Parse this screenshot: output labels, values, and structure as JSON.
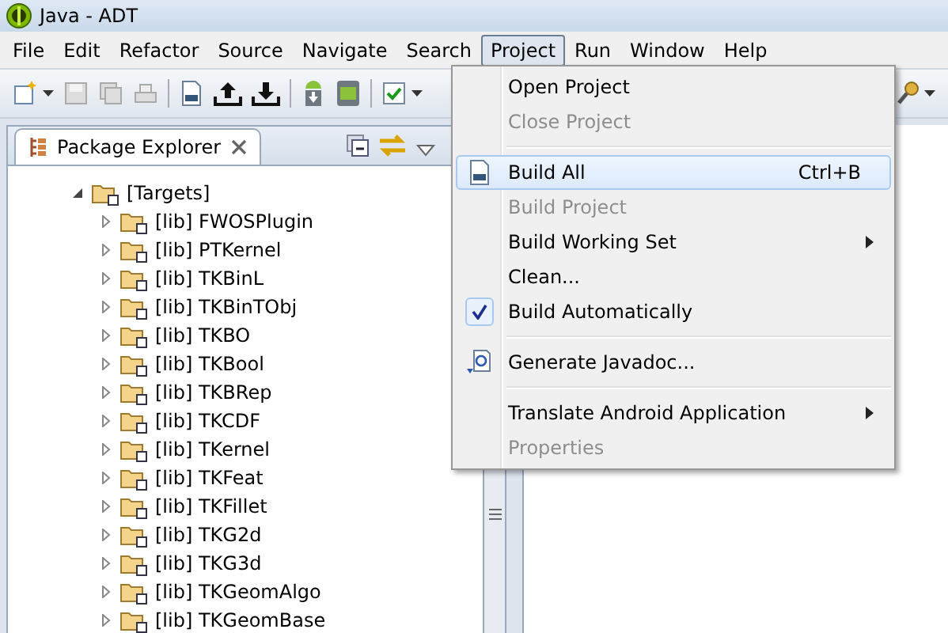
{
  "window": {
    "title": "Java - ADT"
  },
  "menu_bar": [
    {
      "label": "File",
      "selected": false
    },
    {
      "label": "Edit",
      "selected": false
    },
    {
      "label": "Refactor",
      "selected": false
    },
    {
      "label": "Source",
      "selected": false
    },
    {
      "label": "Navigate",
      "selected": false
    },
    {
      "label": "Search",
      "selected": false
    },
    {
      "label": "Project",
      "selected": true
    },
    {
      "label": "Run",
      "selected": false
    },
    {
      "label": "Window",
      "selected": false
    },
    {
      "label": "Help",
      "selected": false
    }
  ],
  "view": {
    "tab": {
      "label": "Package Explorer",
      "selected": true
    }
  },
  "tree": [
    {
      "label": "[Targets]",
      "expanded": true,
      "children": [
        {
          "label": "[lib] FWOSPlugin",
          "expanded": false
        },
        {
          "label": "[lib] PTKernel",
          "expanded": false
        },
        {
          "label": "[lib] TKBinL",
          "expanded": false
        },
        {
          "label": "[lib] TKBinTObj",
          "expanded": false
        },
        {
          "label": "[lib] TKBO",
          "expanded": false
        },
        {
          "label": "[lib] TKBool",
          "expanded": false
        },
        {
          "label": "[lib] TKBRep",
          "expanded": false
        },
        {
          "label": "[lib] TKCDF",
          "expanded": false
        },
        {
          "label": "[lib] TKernel",
          "expanded": false
        },
        {
          "label": "[lib] TKFeat",
          "expanded": false
        },
        {
          "label": "[lib] TKFillet",
          "expanded": false
        },
        {
          "label": "[lib] TKG2d",
          "expanded": false
        },
        {
          "label": "[lib] TKG3d",
          "expanded": false
        },
        {
          "label": "[lib] TKGeomAlgo",
          "expanded": false
        },
        {
          "label": "[lib] TKGeomBase",
          "expanded": false
        }
      ]
    }
  ],
  "project_menu": [
    {
      "kind": "item",
      "label": "Open Project",
      "disabled": false,
      "selected": false
    },
    {
      "kind": "item",
      "label": "Close Project",
      "disabled": true,
      "selected": false
    },
    {
      "kind": "separator"
    },
    {
      "kind": "build",
      "label": "Build All",
      "shortcut": "Ctrl+B",
      "disabled": false,
      "selected": true
    },
    {
      "kind": "item",
      "label": "Build Project",
      "disabled": true,
      "selected": false
    },
    {
      "kind": "item",
      "label": "Build Working Set",
      "submenu": true,
      "disabled": false,
      "selected": false
    },
    {
      "kind": "item",
      "label": "Clean...",
      "disabled": false,
      "selected": false
    },
    {
      "kind": "item",
      "label": "Build Automatically",
      "checked": true,
      "disabled": false,
      "selected": false
    },
    {
      "kind": "separator"
    },
    {
      "kind": "generate",
      "label": "Generate Javadoc...",
      "disabled": false,
      "selected": false
    },
    {
      "kind": "separator"
    },
    {
      "kind": "item",
      "label": "Translate Android Application",
      "submenu": true,
      "disabled": false,
      "selected": false
    },
    {
      "kind": "item",
      "label": "Properties",
      "disabled": true,
      "selected": false
    }
  ]
}
